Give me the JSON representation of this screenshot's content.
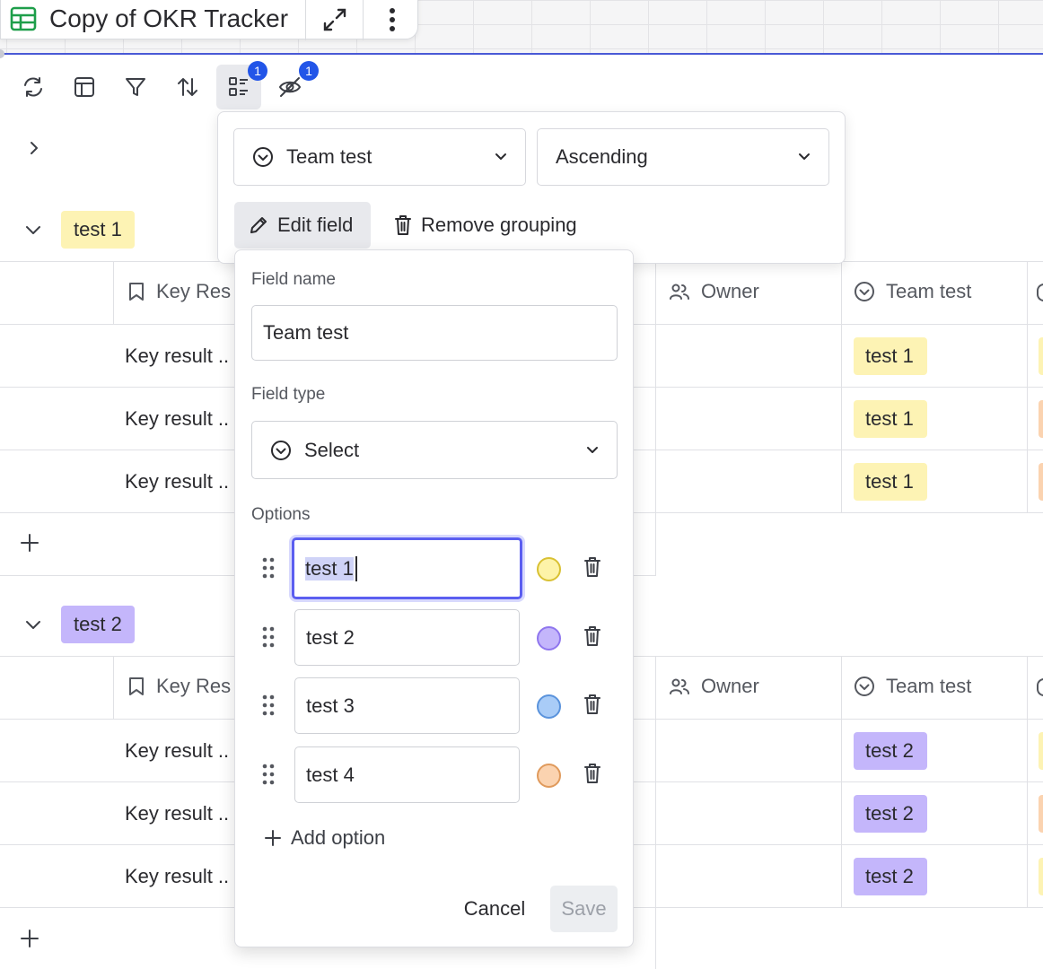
{
  "header": {
    "title": "Copy of OKR Tracker"
  },
  "toolbar": {
    "grouping_badge": "1",
    "hidden_badge": "1"
  },
  "group_popover": {
    "field": "Team test",
    "order": "Ascending",
    "edit_field_label": "Edit field",
    "remove_grouping_label": "Remove grouping"
  },
  "edit_field": {
    "field_name_label": "Field name",
    "field_name_value": "Team test",
    "field_type_label": "Field type",
    "field_type_value": "Select",
    "options_label": "Options",
    "options": [
      {
        "value": "test 1",
        "color": "#fdf3a8",
        "border": "#d9c133"
      },
      {
        "value": "test 2",
        "color": "#c4b6fb",
        "border": "#8f76ee"
      },
      {
        "value": "test 3",
        "color": "#a9ccf7",
        "border": "#5a93dc"
      },
      {
        "value": "test 4",
        "color": "#fbd3b0",
        "border": "#e09a5c"
      }
    ],
    "add_option_label": "Add option",
    "cancel_label": "Cancel",
    "save_label": "Save"
  },
  "columns": {
    "key_result": "Key Res",
    "owner": "Owner",
    "team": "Team test"
  },
  "groups": [
    {
      "tag": "test 1",
      "tag_color": "#fdf3b4",
      "rows": [
        {
          "key_result": "Key result ..",
          "team": "test 1"
        },
        {
          "key_result": "Key result ..",
          "team": "test 1"
        },
        {
          "key_result": "Key result ..",
          "team": "test 1"
        }
      ]
    },
    {
      "tag": "test 2",
      "tag_color": "#c4b6fb",
      "rows": [
        {
          "key_result": "Key result ..",
          "team": "test 2"
        },
        {
          "key_result": "Key result ..",
          "team": "test 2"
        },
        {
          "key_result": "Key result ..",
          "team": "test 2"
        }
      ]
    }
  ]
}
